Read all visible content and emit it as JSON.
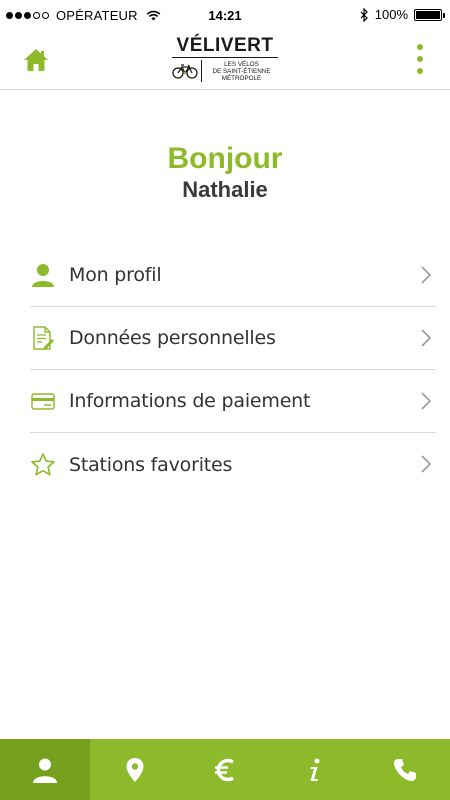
{
  "status_bar": {
    "carrier": "OPÉRATEUR",
    "time": "14:21",
    "battery": "100%",
    "signal_bars_filled": 3,
    "signal_bars_total": 5
  },
  "header": {
    "logo_title": "VÉLIVERT",
    "logo_tagline_1": "LES VÉLOS",
    "logo_tagline_2": "DE SAINT-ÉTIENNE",
    "logo_tagline_3": "MÉTROPOLE",
    "home_icon": "home-icon",
    "menu_icon": "vertical-dots-icon"
  },
  "greeting": {
    "hello": "Bonjour",
    "name": "Nathalie"
  },
  "menu": {
    "items": [
      {
        "label": "Mon profil",
        "icon": "user-icon"
      },
      {
        "label": "Données personnelles",
        "icon": "document-edit-icon"
      },
      {
        "label": "Informations de paiement",
        "icon": "credit-card-icon"
      },
      {
        "label": "Stations favorites",
        "icon": "star-icon"
      }
    ]
  },
  "bottom_nav": {
    "tabs": [
      {
        "icon": "user-icon",
        "active": true
      },
      {
        "icon": "map-pin-icon",
        "active": false
      },
      {
        "icon": "euro-icon",
        "active": false
      },
      {
        "icon": "info-icon",
        "active": false
      },
      {
        "icon": "phone-icon",
        "active": false
      }
    ]
  },
  "colors": {
    "accent": "#8dba2b",
    "accent_dark": "#76a11f",
    "text": "#333333",
    "divider": "#d9d9d9"
  }
}
